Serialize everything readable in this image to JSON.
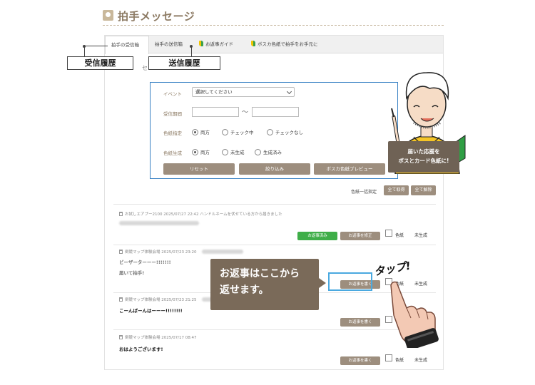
{
  "header": {
    "title": "拍手メッセージ"
  },
  "tabs": [
    {
      "label": "拍手の受信箱"
    },
    {
      "label": "拍手の送信箱"
    },
    {
      "label": "お返事ガイド"
    },
    {
      "label": "ボスカ色紙で拍手をお手元に"
    }
  ],
  "callouts": {
    "received": "受信履歴",
    "sent": "送信履歴",
    "partial_char": "セ"
  },
  "search": {
    "event_label": "イベント",
    "event_select": "選択してください",
    "period_label": "受信期間",
    "period_sep": "〜",
    "shikishi_label": "色紙指定",
    "shikishi_options": [
      "両方",
      "チェック中",
      "チェックなし"
    ],
    "generate_label": "色紙生成",
    "generate_options": [
      "両方",
      "未生成",
      "生成済み"
    ],
    "reset_label": "リセット",
    "filter_label": "絞り込み",
    "preview_label": "ボスカ色紙プレビュー"
  },
  "bulk": {
    "label": "色紙一括指定",
    "select_all": "全て取得",
    "clear_all": "全て解除"
  },
  "messages": [
    {
      "meta": "お試しエアプー2100 2025/07/27 22:42 ハンドルネームを伏せている方から届きました",
      "body": "",
      "status_badge": "お返事済み",
      "action": "お返事を修正",
      "check_label": "色紙",
      "state": "未生成"
    },
    {
      "meta": "倒競マップ体験会場 2025/07/23 23:20",
      "body": "ビーザーターーー!!!!!!!",
      "body2": "届いて拍手!",
      "action": "お返事を書く",
      "check_label": "色紙",
      "state": "未生成"
    },
    {
      "meta": "倒競マップ体験会場 2025/07/23 21:25",
      "body": "こーんばーんはーーー!!!!!!!!",
      "action": "お返事を書く",
      "check_label": "色紙",
      "state": "未生成"
    },
    {
      "meta": "倒競マップ体験会場 2025/07/17 08:47",
      "body": "おはようございます!",
      "action": "お返事を書く",
      "check_label": "色紙",
      "state": "未生成"
    }
  ],
  "tooltip": {
    "line1": "お返事はここから",
    "line2": "返せます。"
  },
  "tap": "タップ!",
  "mascot": {
    "line1": "届いた応援を",
    "line2": "ボスとカード色紙に!"
  },
  "colors": {
    "accent": "#9d8e7e",
    "highlight": "#4aa9e0",
    "success": "#3fae49",
    "tooltip": "#7a6a59"
  }
}
